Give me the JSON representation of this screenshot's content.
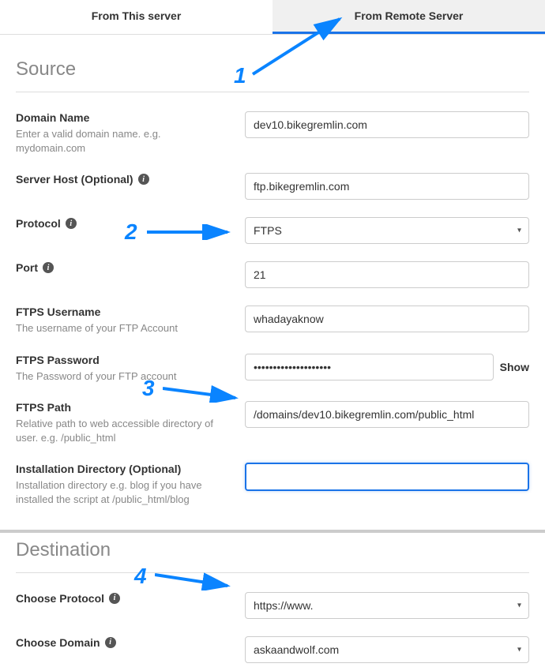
{
  "tabs": {
    "this_server": "From This server",
    "remote_server": "From Remote Server"
  },
  "source": {
    "title": "Source",
    "domain": {
      "label": "Domain Name",
      "hint": "Enter a valid domain name. e.g. mydomain.com",
      "value": "dev10.bikegremlin.com"
    },
    "server_host": {
      "label": "Server Host (Optional)",
      "value": "ftp.bikegremlin.com"
    },
    "protocol": {
      "label": "Protocol",
      "value": "FTPS"
    },
    "port": {
      "label": "Port",
      "value": "21"
    },
    "ftps_user": {
      "label": "FTPS Username",
      "hint": "The username of your FTP Account",
      "value": "whadayaknow"
    },
    "ftps_pass": {
      "label": "FTPS Password",
      "hint": "The Password of your FTP account",
      "value": "••••••••••••••••••••",
      "show": "Show"
    },
    "ftps_path": {
      "label": "FTPS Path",
      "hint": "Relative path to web accessible directory of user. e.g. /public_html",
      "value": "/domains/dev10.bikegremlin.com/public_html"
    },
    "install_dir": {
      "label": "Installation Directory (Optional)",
      "hint": "Installation directory e.g. blog if you have installed the script at /public_html/blog",
      "value": ""
    }
  },
  "destination": {
    "title": "Destination",
    "protocol": {
      "label": "Choose Protocol",
      "value": "https://www."
    },
    "domain": {
      "label": "Choose Domain",
      "value": "askaandwolf.com"
    }
  },
  "annotations": {
    "n1": "1",
    "n2": "2",
    "n3": "3",
    "n4": "4"
  }
}
